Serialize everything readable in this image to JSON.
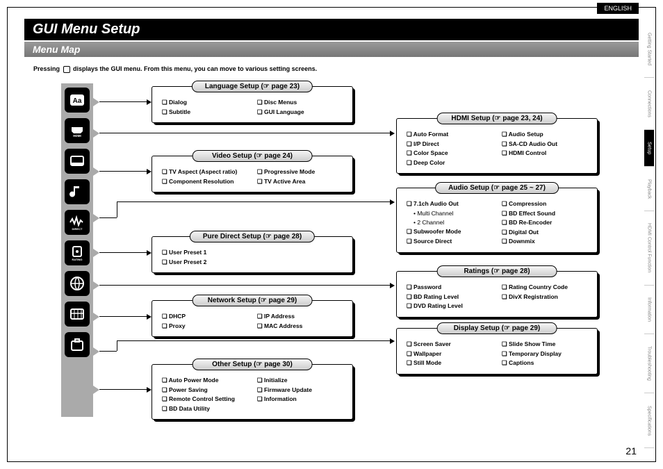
{
  "lang_tab": "ENGLISH",
  "title": "GUI Menu Setup",
  "subtitle": "Menu Map",
  "intro_before": "Pressing ",
  "intro_after": " displays the GUI menu. From this menu, you can move to various setting screens.",
  "page_number": "21",
  "side_tabs": [
    {
      "label": "Getting Started",
      "active": false
    },
    {
      "label": "Connections",
      "active": false
    },
    {
      "label": "Setup",
      "active": true
    },
    {
      "label": "Playback",
      "active": false
    },
    {
      "label": "HDMI Control Function",
      "active": false
    },
    {
      "label": "Information",
      "active": false
    },
    {
      "label": "Troubleshooting",
      "active": false
    },
    {
      "label": "Specifications",
      "active": false
    }
  ],
  "icons": [
    "language",
    "hdmi",
    "video",
    "audio",
    "direct",
    "rating",
    "network",
    "display",
    "other"
  ],
  "cards": {
    "language": {
      "title": "Language Setup (☞ page 23)",
      "cols": [
        [
          "Dialog",
          "Subtitle"
        ],
        [
          "Disc Menus",
          "GUI Language"
        ]
      ]
    },
    "video": {
      "title": "Video Setup (☞ page 24)",
      "cols": [
        [
          "TV Aspect (Aspect ratio)",
          "Component Resolution"
        ],
        [
          "Progressive Mode",
          "TV Active Area"
        ]
      ]
    },
    "pure": {
      "title": "Pure Direct Setup (☞ page 28)",
      "cols": [
        [
          "User Preset 1",
          "User Preset 2"
        ],
        []
      ]
    },
    "network": {
      "title": "Network Setup (☞ page 29)",
      "cols": [
        [
          "DHCP",
          "Proxy"
        ],
        [
          "IP Address",
          "MAC Address"
        ]
      ]
    },
    "other": {
      "title": "Other Setup (☞ page 30)",
      "cols": [
        [
          "Auto Power Mode",
          "Power Saving",
          "Remote Control Setting",
          "BD Data Utility"
        ],
        [
          "Initialize",
          "Firmware Update",
          "Information"
        ]
      ]
    },
    "hdmi": {
      "title": "HDMI Setup (☞ page 23, 24)",
      "cols": [
        [
          "Auto Format",
          "I/P Direct",
          "Color Space",
          "Deep Color"
        ],
        [
          "Audio Setup",
          "SA-CD Audio Out",
          "HDMI Control"
        ]
      ]
    },
    "audio": {
      "title": "Audio Setup (☞ page 25 ~ 27)",
      "cols_special": {
        "left": [
          {
            "t": "item",
            "v": "7.1ch Audio Out"
          },
          {
            "t": "sub",
            "v": "Multi Channel"
          },
          {
            "t": "sub",
            "v": "2 Channel"
          },
          {
            "t": "item",
            "v": "Subwoofer Mode"
          },
          {
            "t": "item",
            "v": "Source Direct"
          }
        ],
        "right": [
          {
            "t": "item",
            "v": "Compression"
          },
          {
            "t": "item",
            "v": "BD Effect Sound"
          },
          {
            "t": "item",
            "v": "BD Re-Encoder"
          },
          {
            "t": "item",
            "v": "Digital Out"
          },
          {
            "t": "item",
            "v": "Downmix"
          }
        ]
      }
    },
    "ratings": {
      "title": "Ratings (☞ page 28)",
      "cols": [
        [
          "Password",
          "BD Rating Level",
          "DVD Rating Level"
        ],
        [
          "Rating Country Code",
          "DivX Registration"
        ]
      ]
    },
    "display": {
      "title": "Display Setup (☞ page 29)",
      "cols": [
        [
          "Screen Saver",
          "Wallpaper",
          "Still Mode"
        ],
        [
          "Slide Show Time",
          "Temporary Display",
          "Captions"
        ]
      ]
    }
  }
}
